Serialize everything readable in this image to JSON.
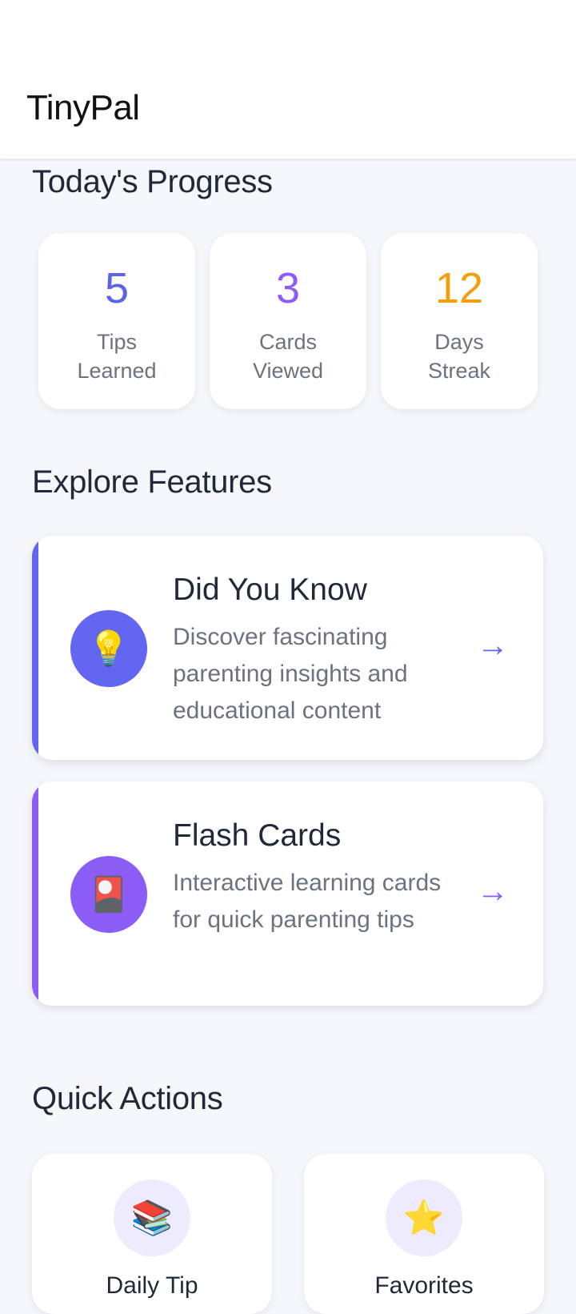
{
  "header": {
    "title": "TinyPal"
  },
  "progress": {
    "title": "Today's Progress",
    "stats": [
      {
        "value": "5",
        "label": "Tips\nLearned",
        "color": "#5b63e6"
      },
      {
        "value": "3",
        "label": "Cards\nViewed",
        "color": "#8b5cf6"
      },
      {
        "value": "12",
        "label": "Days\nStreak",
        "color": "#f59e0b"
      }
    ]
  },
  "features": {
    "title": "Explore Features",
    "items": [
      {
        "title": "Did You Know",
        "description": "Discover fascinating parenting insights and educational content",
        "icon": "💡",
        "icon_name": "lightbulb-icon",
        "arrow": "→",
        "accent": "#6366f1"
      },
      {
        "title": "Flash Cards",
        "description": "Interactive learning cards for quick parenting tips",
        "icon": "🎴",
        "icon_name": "flash-card-icon",
        "arrow": "→",
        "accent": "#8b5cf6"
      }
    ]
  },
  "quick_actions": {
    "title": "Quick Actions",
    "items": [
      {
        "label": "Daily Tip",
        "icon": "📚",
        "icon_name": "books-icon"
      },
      {
        "label": "Favorites",
        "icon": "⭐",
        "icon_name": "star-icon"
      }
    ]
  }
}
